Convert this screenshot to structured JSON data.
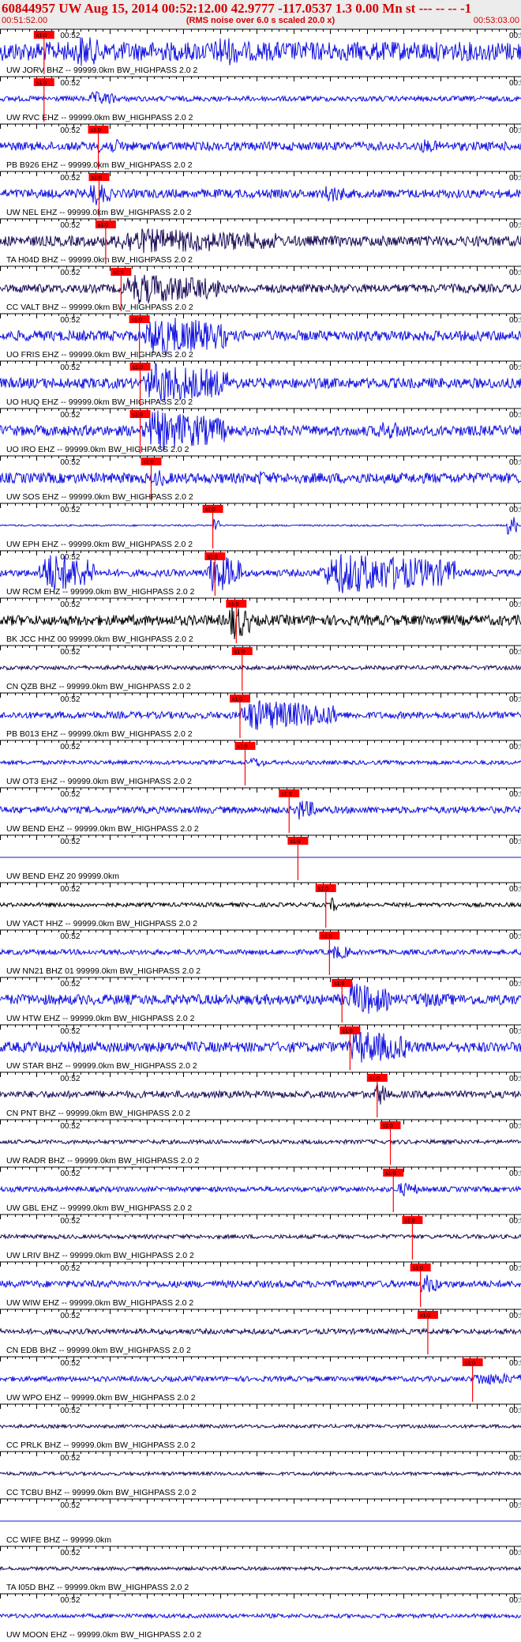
{
  "header": {
    "title": "60844957 UW Aug 15, 2014 00:52:12.00   42.9777 -117.0537  1.3 0.00 Mn st --- -- --   -1",
    "subtitle": "(RMS noise over 6.0 s scaled 20.0 x)",
    "start_time": "00:51:52.00",
    "end_time": "00:53:03.00"
  },
  "colors": {
    "title": "#d40000",
    "axis": "#000000",
    "pick": "#ff0000",
    "blue": "#1010e0",
    "black": "#000000",
    "purple": "#1b0a55"
  },
  "chart_data": {
    "type": "line",
    "title": "60844957 UW Aug 15, 2014 00:52:12.00   42.9777 -117.0537  1.3 0.00 Mn st --- -- --   -1",
    "subtitle": "(RMS noise over 6.0 s scaled 20.0 x)",
    "x_range_seconds": [
      0,
      71
    ],
    "time_labels": {
      "start": "00:51:52.00",
      "minute": "00:52",
      "end": "00:53:03.00",
      "right_edge": "00:5"
    },
    "pick_label": "s1:0",
    "series": [
      {
        "name": "UW JORV BHZ -- 99999.0km BW_HIGHPASS  2.0  2",
        "color": "blue",
        "pick": 6.0,
        "amp": 0.55,
        "bursts": [
          [
            10,
            14,
            1.0
          ],
          [
            29,
            33,
            1.0
          ]
        ]
      },
      {
        "name": "UW RVC EHZ -- 99999.0km BW_HIGHPASS  2.0  2",
        "color": "blue",
        "pick": 6.0,
        "amp": 0.15,
        "bursts": [
          [
            12,
            16,
            0.35
          ]
        ]
      },
      {
        "name": "PB B926 EHZ -- 99999.0km BW_HIGHPASS  2.0  2",
        "color": "blue",
        "pick": 13.4,
        "amp": 0.25,
        "bursts": [
          [
            13,
            18,
            0.4
          ],
          [
            57,
            60,
            0.35
          ]
        ]
      },
      {
        "name": "UW NEL EHZ -- 99999.0km BW_HIGHPASS  2.0  2",
        "color": "blue",
        "pick": 13.5,
        "amp": 0.25,
        "bursts": [
          [
            12,
            15,
            0.7
          ],
          [
            44,
            47,
            0.5
          ]
        ]
      },
      {
        "name": "TA H04D BHZ -- 99999.0km BW_HIGHPASS  2.0  2",
        "color": "purple",
        "pick": 14.4,
        "amp": 0.3,
        "bursts": [
          [
            14,
            38,
            0.7
          ]
        ]
      },
      {
        "name": "CC VALT BHZ -- 99999.0km BW_HIGHPASS  2.0  2",
        "color": "purple",
        "pick": 16.5,
        "amp": 0.25,
        "bursts": [
          [
            16,
            30,
            0.9
          ]
        ]
      },
      {
        "name": "UO FRIS EHZ -- 99999.0km BW_HIGHPASS  2.0  2",
        "color": "blue",
        "pick": 19.0,
        "amp": 0.3,
        "bursts": [
          [
            19,
            31,
            1.2
          ]
        ]
      },
      {
        "name": "UO HUQ EHZ -- 99999.0km BW_HIGHPASS  2.0  2",
        "color": "blue",
        "pick": 19.1,
        "amp": 0.3,
        "bursts": [
          [
            19,
            31,
            1.2
          ]
        ]
      },
      {
        "name": "UO IRO EHZ -- 99999.0km BW_HIGHPASS  2.0  2",
        "color": "blue",
        "pick": 19.1,
        "amp": 0.3,
        "bursts": [
          [
            19,
            31,
            1.2
          ],
          [
            51,
            56,
            0.5
          ]
        ]
      },
      {
        "name": "UW SOS EHZ -- 99999.0km BW_HIGHPASS  2.0  2",
        "color": "blue",
        "pick": 20.6,
        "amp": 0.3,
        "bursts": [
          [
            21,
            23,
            0.5
          ],
          [
            35,
            37,
            0.4
          ],
          [
            48,
            50,
            0.3
          ]
        ]
      },
      {
        "name": "UW EPH EHZ -- 99999.0km BW_HIGHPASS  2.0  2",
        "color": "blue",
        "pick": 29.0,
        "amp": 0.05,
        "bursts": [
          [
            29,
            30,
            0.5
          ],
          [
            69,
            70.5,
            0.6
          ]
        ]
      },
      {
        "name": "UW RCM EHZ -- 99999.0km BW_HIGHPASS  2.0  2",
        "color": "blue",
        "pick": 29.3,
        "amp": 0.2,
        "bursts": [
          [
            5,
            13,
            1.2
          ],
          [
            28,
            33,
            1.2
          ],
          [
            43,
            62,
            1.2
          ]
        ]
      },
      {
        "name": "BK JCC HHZ 00 99999.0km BW_HIGHPASS  2.0  2",
        "color": "black",
        "pick": 32.2,
        "amp": 0.3,
        "bursts": [
          [
            31,
            34,
            1.2
          ]
        ]
      },
      {
        "name": "CN QZB BHZ -- 99999.0km BW_HIGHPASS  2.0  2",
        "color": "purple",
        "pick": 33.0,
        "amp": 0.12,
        "bursts": []
      },
      {
        "name": "PB B013 EHZ -- 99999.0km BW_HIGHPASS  2.0  2",
        "color": "blue",
        "pick": 32.7,
        "amp": 0.2,
        "bursts": [
          [
            32,
            46,
            0.9
          ]
        ]
      },
      {
        "name": "UW OT3 EHZ -- 99999.0km BW_HIGHPASS  2.0  2",
        "color": "blue",
        "pick": 33.4,
        "amp": 0.12,
        "bursts": [
          [
            34,
            36,
            0.25
          ]
        ]
      },
      {
        "name": "UW BEND EHZ -- 99999.0km BW_HIGHPASS  2.0  2",
        "color": "blue",
        "pick": 39.4,
        "amp": 0.2,
        "bursts": [
          [
            40,
            43,
            0.6
          ]
        ]
      },
      {
        "name": "UW BEND EHZ 20 99999.0km",
        "color": "blue",
        "pick": 40.6,
        "amp": 0.0,
        "bursts": []
      },
      {
        "name": "UW YACT HHZ -- 99999.0km BW_HIGHPASS  2.0  2",
        "color": "black",
        "pick": 44.4,
        "amp": 0.12,
        "bursts": [
          [
            45,
            46,
            0.4
          ]
        ]
      },
      {
        "name": "UW NN21 BHZ 01 99999.0km BW_HIGHPASS  2.0  2",
        "color": "blue",
        "pick": 44.9,
        "amp": 0.15,
        "bursts": [
          [
            45,
            48,
            0.35
          ]
        ]
      },
      {
        "name": "UW HTW EHZ -- 99999.0km BW_HIGHPASS  2.0  2",
        "color": "blue",
        "pick": 46.6,
        "amp": 0.3,
        "bursts": [
          [
            47,
            53,
            1.0
          ],
          [
            56,
            62,
            0.4
          ]
        ]
      },
      {
        "name": "UW STAR BHZ -- 99999.0km BW_HIGHPASS  2.0  2",
        "color": "blue",
        "pick": 47.7,
        "amp": 0.3,
        "bursts": [
          [
            47,
            56,
            1.0
          ]
        ]
      },
      {
        "name": "CN PNT BHZ -- 99999.0km BW_HIGHPASS  2.0  2",
        "color": "purple",
        "pick": 51.4,
        "amp": 0.2,
        "bursts": [
          [
            51,
            53,
            0.7
          ]
        ]
      },
      {
        "name": "UW RADR BHZ -- 99999.0km BW_HIGHPASS  2.0  2",
        "color": "purple",
        "pick": 53.2,
        "amp": 0.12,
        "bursts": []
      },
      {
        "name": "UW GBL EHZ -- 99999.0km BW_HIGHPASS  2.0  2",
        "color": "blue",
        "pick": 53.6,
        "amp": 0.15,
        "bursts": [
          [
            54,
            57,
            0.35
          ]
        ]
      },
      {
        "name": "UW LRIV BHZ -- 99999.0km BW_HIGHPASS  2.0  2",
        "color": "purple",
        "pick": 56.2,
        "amp": 0.12,
        "bursts": []
      },
      {
        "name": "UW WIW EHZ -- 99999.0km BW_HIGHPASS  2.0  2",
        "color": "blue",
        "pick": 57.3,
        "amp": 0.2,
        "bursts": [
          [
            57,
            60,
            0.55
          ]
        ]
      },
      {
        "name": "CN EDB BHZ -- 99999.0km BW_HIGHPASS  2.0  2",
        "color": "purple",
        "pick": 58.3,
        "amp": 0.15,
        "bursts": []
      },
      {
        "name": "UW WPO EHZ -- 99999.0km BW_HIGHPASS  2.0  2",
        "color": "blue",
        "pick": 64.4,
        "amp": 0.15,
        "bursts": [
          [
            64,
            71,
            0.3
          ]
        ]
      },
      {
        "name": "CC PRLK BHZ -- 99999.0km BW_HIGHPASS  2.0  2",
        "color": "purple",
        "pick": null,
        "amp": 0.1,
        "bursts": []
      },
      {
        "name": "CC TCBU BHZ -- 99999.0km BW_HIGHPASS  2.0  2",
        "color": "purple",
        "pick": null,
        "amp": 0.1,
        "bursts": []
      },
      {
        "name": "CC WIFE BHZ -- 99999.0km",
        "color": "blue",
        "pick": null,
        "amp": 0.0,
        "bursts": []
      },
      {
        "name": "TA I05D BHZ -- 99999.0km BW_HIGHPASS  2.0  2",
        "color": "purple",
        "pick": null,
        "amp": 0.1,
        "bursts": []
      },
      {
        "name": "UW MOON EHZ -- 99999.0km BW_HIGHPASS  2.0  2",
        "color": "blue",
        "pick": null,
        "amp": 0.12,
        "bursts": []
      }
    ]
  }
}
